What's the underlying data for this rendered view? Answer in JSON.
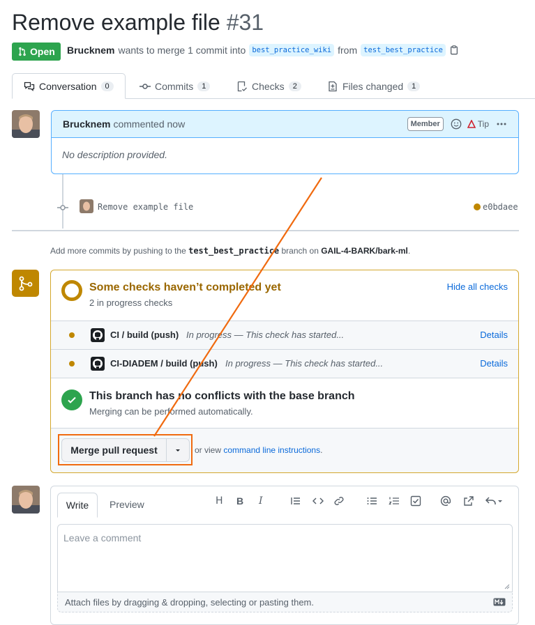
{
  "header": {
    "title": "Remove example file",
    "number": "#31"
  },
  "state": {
    "label": "Open"
  },
  "meta": {
    "author": "Brucknem",
    "text_before": "wants to merge 1 commit into",
    "base_branch": "best_practice_wiki",
    "text_from": "from",
    "head_branch": "test_best_practice"
  },
  "tabs": [
    {
      "label": "Conversation",
      "count": "0"
    },
    {
      "label": "Commits",
      "count": "1"
    },
    {
      "label": "Checks",
      "count": "2"
    },
    {
      "label": "Files changed",
      "count": "1"
    }
  ],
  "comment": {
    "author": "Brucknem",
    "action": "commented now",
    "badge": "Member",
    "tip": "Tip",
    "body": "No description provided."
  },
  "commit": {
    "message": "Remove example file",
    "sha": "e0bdaee"
  },
  "hint": {
    "pre": "Add more commits by pushing to the",
    "branch": "test_best_practice",
    "mid": "branch on",
    "repo": "GAIL-4-BARK/bark-ml",
    "post": "."
  },
  "checks": {
    "title": "Some checks haven’t completed yet",
    "subtitle": "2 in progress checks",
    "hide_label": "Hide all checks",
    "items": [
      {
        "name": "CI / build (push)",
        "status": "In progress — This check has started...",
        "details": "Details"
      },
      {
        "name": "CI-DIADEM / build (push)",
        "status": "In progress — This check has started...",
        "details": "Details"
      }
    ]
  },
  "conflicts": {
    "title": "This branch has no conflicts with the base branch",
    "subtitle": "Merging can be performed automatically."
  },
  "merge": {
    "button": "Merge pull request",
    "or_view": "or view",
    "cli_link": "command line instructions",
    "period": "."
  },
  "editor": {
    "write_tab": "Write",
    "preview_tab": "Preview",
    "placeholder": "Leave a comment",
    "attach_hint": "Attach files by dragging & dropping, selecting or pasting them."
  },
  "colors": {
    "open_green": "#2da44e",
    "pending_yellow": "#bf8700",
    "link_blue": "#0969da",
    "annotation_orange": "#f06a0f"
  }
}
